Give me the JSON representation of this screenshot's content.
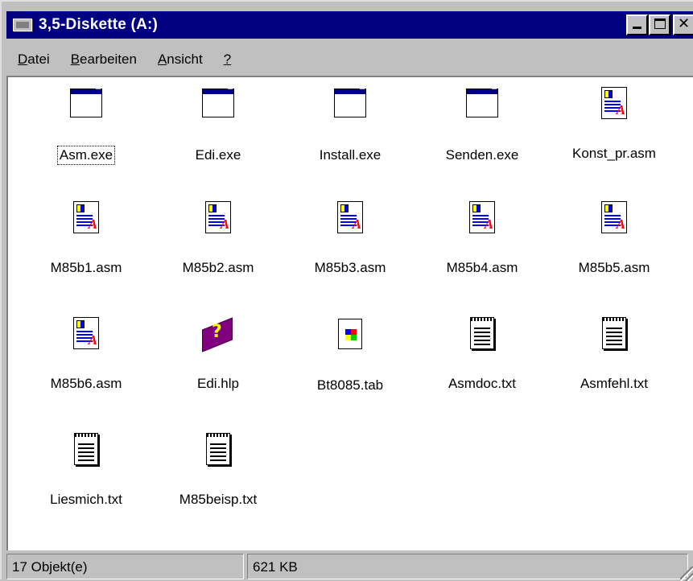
{
  "window": {
    "title": "3,5-Diskette (A:)"
  },
  "menu": [
    {
      "label_underlined": "D",
      "label_rest": "atei"
    },
    {
      "label_underlined": "B",
      "label_rest": "earbeiten"
    },
    {
      "label_underlined": "A",
      "label_rest": "nsicht"
    },
    {
      "label_underlined": "?",
      "label_rest": ""
    }
  ],
  "files": [
    {
      "name": "Asm.exe",
      "icon": "exe-icon"
    },
    {
      "name": "Edi.exe",
      "icon": "exe-icon"
    },
    {
      "name": "Install.exe",
      "icon": "exe-icon"
    },
    {
      "name": "Senden.exe",
      "icon": "exe-icon"
    },
    {
      "name": "Konst_pr.asm",
      "icon": "asm-file-icon"
    },
    {
      "name": "M85b1.asm",
      "icon": "asm-file-icon"
    },
    {
      "name": "M85b2.asm",
      "icon": "asm-file-icon"
    },
    {
      "name": "M85b3.asm",
      "icon": "asm-file-icon"
    },
    {
      "name": "M85b4.asm",
      "icon": "asm-file-icon"
    },
    {
      "name": "M85b5.asm",
      "icon": "asm-file-icon"
    },
    {
      "name": "M85b6.asm",
      "icon": "asm-file-icon"
    },
    {
      "name": "Edi.hlp",
      "icon": "help-book-icon"
    },
    {
      "name": "Bt8085.tab",
      "icon": "tab-file-icon"
    },
    {
      "name": "Asmdoc.txt",
      "icon": "text-file-icon"
    },
    {
      "name": "Asmfehl.txt",
      "icon": "text-file-icon"
    },
    {
      "name": "Liesmich.txt",
      "icon": "text-file-icon"
    },
    {
      "name": "M85beisp.txt",
      "icon": "text-file-icon"
    }
  ],
  "status": {
    "object_count": "17 Objekt(e)",
    "size": "621 KB"
  }
}
